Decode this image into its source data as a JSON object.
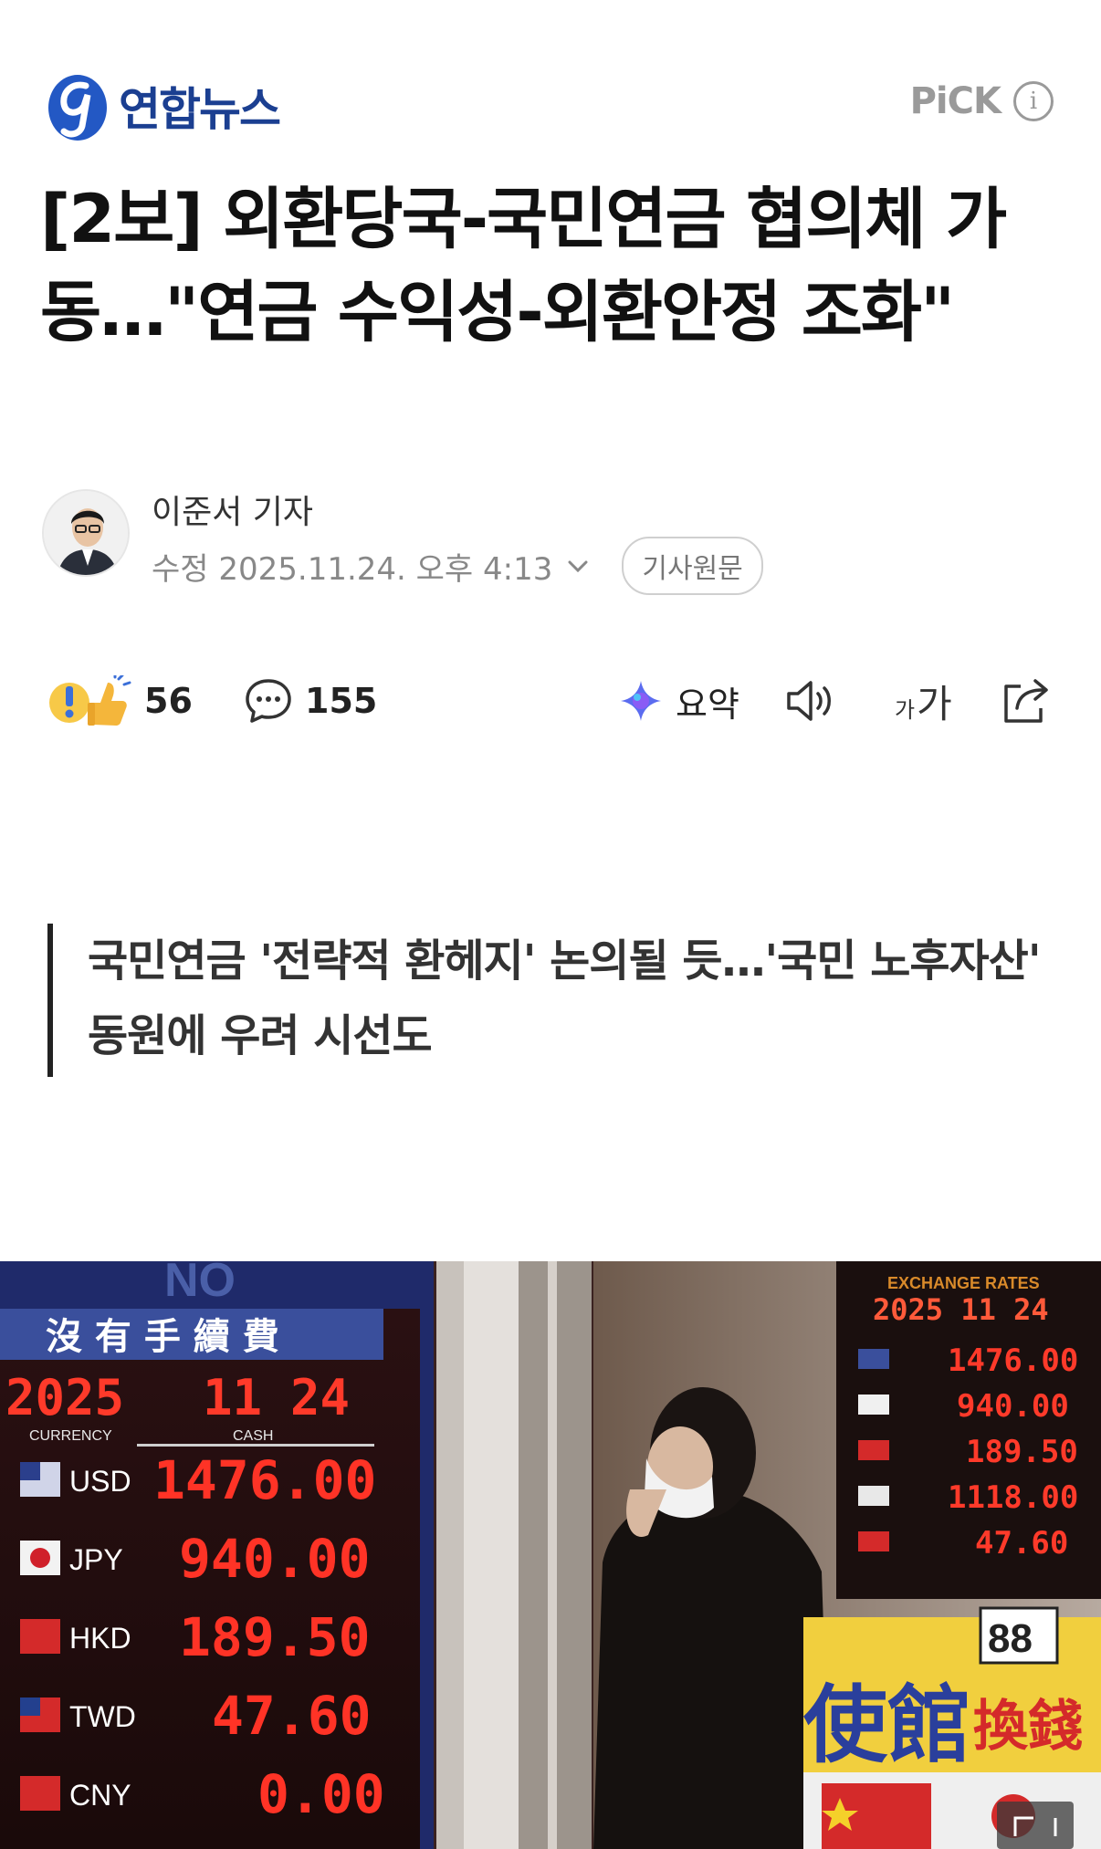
{
  "header": {
    "brand": "연합뉴스",
    "pick_label": "PiCK",
    "info_glyph": "i",
    "colors": {
      "brand": "#1b3f91",
      "muted": "#9a9a9a"
    }
  },
  "article": {
    "headline": "[2보] 외환당국-국민연금 협의체 가동…\"연금 수익성-외환안정 조화\"",
    "reporter": "이준서 기자",
    "date": "수정 2025.11.24. 오후 4:13",
    "original_button": "기사원문",
    "summary": "국민연금 '전략적 환헤지' 논의될 듯…'국민 노후자산' 동원에 우려 시선도"
  },
  "actions": {
    "reaction_count": "56",
    "comment_count": "155",
    "summary_label": "요약",
    "font_size_small": "가",
    "font_size_large": "가"
  },
  "photo": {
    "left_board": {
      "header": "沒 有 手 續 費",
      "date": [
        "2025",
        "11",
        "24"
      ],
      "col_currency": "CURRENCY",
      "col_cash": "CASH",
      "rows": [
        {
          "code": "USD",
          "value": "1476.00"
        },
        {
          "code": "JPY",
          "value": "940.00"
        },
        {
          "code": "HKD",
          "value": "189.50"
        },
        {
          "code": "TWD",
          "value": "47.60"
        },
        {
          "code": "CNY",
          "value": "0.00"
        }
      ]
    },
    "right_board": {
      "title": "EXCHANGE RATES",
      "date": "2025 11 24",
      "values": [
        "1476.00",
        "940.00",
        "189.50",
        "1118.00",
        "47.60"
      ]
    },
    "sign_text": "使館",
    "sign_sub": "換錢",
    "sign_number": "88",
    "top_sign": "NO"
  }
}
